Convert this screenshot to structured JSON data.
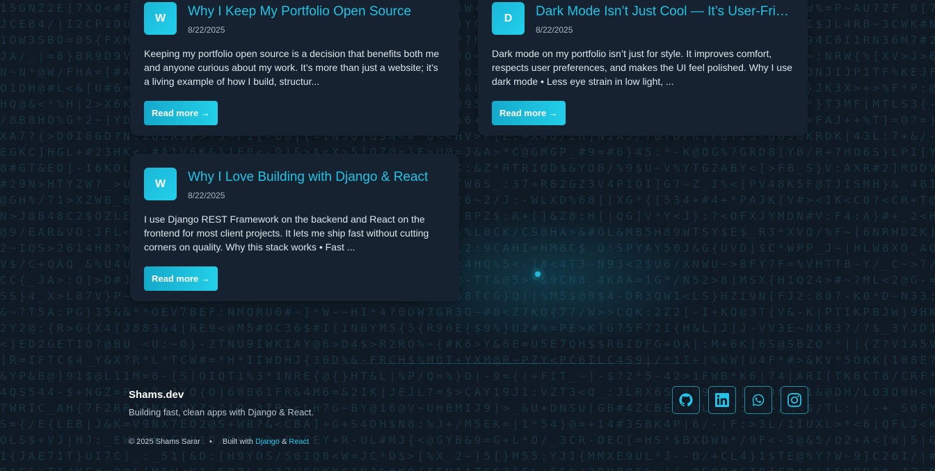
{
  "posts": [
    {
      "avatar": "W",
      "title": "Why I Keep My Portfolio Open Source",
      "date": "8/22/2025",
      "excerpt": "Keeping my portfolio open source is a decision that benefits both me and anyone curious about my work. It’s more than just a website; it’s a living example of how I build, structur...",
      "button": "Read more →"
    },
    {
      "avatar": "D",
      "title": "Dark Mode Isn’t Just Cool — It’s User-Frien...",
      "date": "8/22/2025",
      "excerpt": "Dark mode on my portfolio isn’t just for style. It improves comfort, respects user preferences, and makes the UI feel polished. Why I use dark mode • Less eye strain in low light, ...",
      "button": "Read more →"
    },
    {
      "avatar": "W",
      "title": "Why I Love Building with Django & React",
      "date": "8/22/2025",
      "excerpt": "I use Django REST Framework on the backend and React on the frontend for most client projects. It lets me ship fast without cutting corners on quality. Why this stack works • Fast ...",
      "button": "Read more →"
    }
  ],
  "footer": {
    "brand": "Shams.dev",
    "tagline": "Building fast, clean apps with Django & React.",
    "copyright": "© 2025 Shams Sarar",
    "separator": "•",
    "built_with": "Built with",
    "tech1": "Django",
    "amp": "&",
    "tech2": "React"
  },
  "socials": [
    {
      "icon": "github-icon"
    },
    {
      "icon": "linkedin-icon"
    },
    {
      "icon": "whatsapp-icon"
    },
    {
      "icon": "instagram-icon"
    }
  ],
  "colors": {
    "accent": "#22c3e6",
    "background": "#0f1a24",
    "card": "#16222f"
  }
}
